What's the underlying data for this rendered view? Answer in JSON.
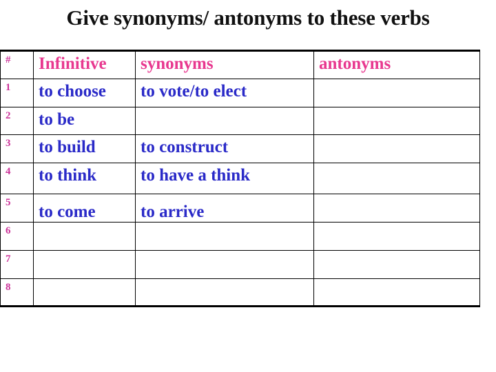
{
  "title": "Give synonyms/ antonyms to these verbs",
  "colors": {
    "header_text": "#e8388f",
    "number_text": "#cc3399",
    "body_text": "#2a2ac8",
    "border": "#000000"
  },
  "table": {
    "headers": {
      "number": "#",
      "infinitive": "Infinitive",
      "synonyms": "synonyms",
      "antonyms": "antonyms"
    },
    "rows": [
      {
        "number": "1",
        "infinitive": "to choose",
        "synonyms": "to vote/to elect",
        "antonyms": ""
      },
      {
        "number": "2",
        "infinitive": "to be",
        "synonyms": "",
        "antonyms": ""
      },
      {
        "number": "3",
        "infinitive": "to build",
        "synonyms": "to construct",
        "antonyms": ""
      },
      {
        "number": "4",
        "infinitive": "to think",
        "synonyms": "to have a think",
        "antonyms": ""
      },
      {
        "number": "5",
        "infinitive": "to come",
        "synonyms": "to arrive",
        "antonyms": ""
      },
      {
        "number": "6",
        "infinitive": "",
        "synonyms": "",
        "antonyms": ""
      },
      {
        "number": "7",
        "infinitive": "",
        "synonyms": "",
        "antonyms": ""
      },
      {
        "number": "8",
        "infinitive": "",
        "synonyms": "",
        "antonyms": ""
      }
    ]
  }
}
